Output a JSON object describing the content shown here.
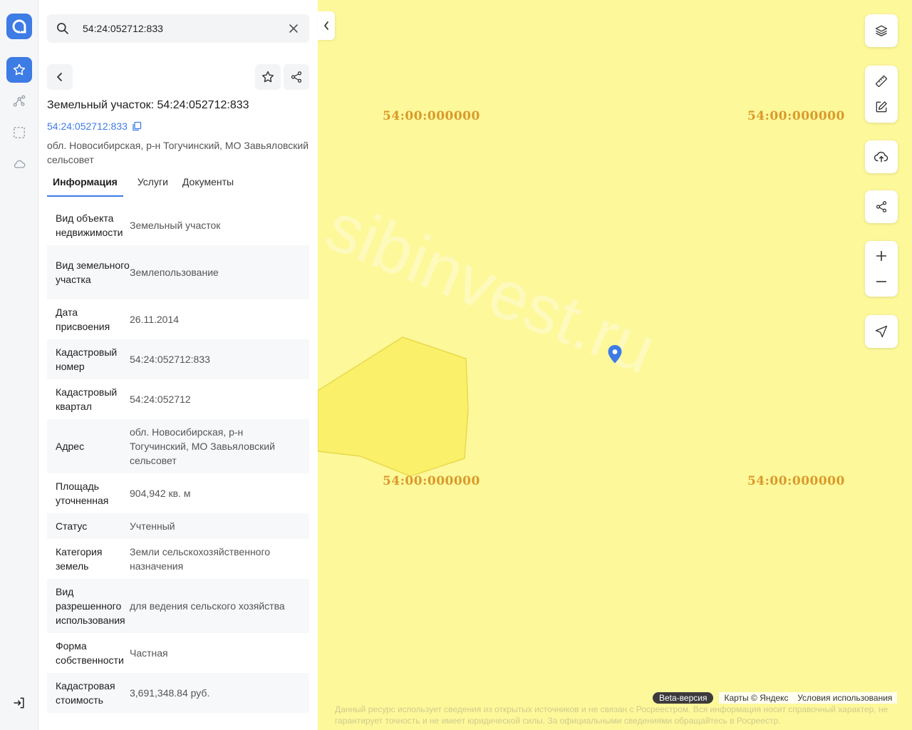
{
  "search": {
    "value": "54:24:052712:833"
  },
  "object": {
    "title": "Земельный участок: 54:24:052712:833",
    "cad_link": "54:24:052712:833",
    "address": "обл. Новосибирская, р-н Тогучинский, МО Завьяловский сельсовет"
  },
  "tabs": [
    {
      "label": "Информация",
      "active": true
    },
    {
      "label": "Услуги",
      "active": false
    },
    {
      "label": "Документы",
      "active": false
    }
  ],
  "info_rows": [
    {
      "key": "Вид объекта недвижимости",
      "value": "Земельный участок"
    },
    {
      "key": "Вид земельного участка",
      "value": "Землепользование"
    },
    {
      "key": "Дата присвоения",
      "value": "26.11.2014"
    },
    {
      "key": "Кадастровый номер",
      "value": "54:24:052712:833"
    },
    {
      "key": "Кадастровый квартал",
      "value": "54:24:052712"
    },
    {
      "key": "Адрес",
      "value": "обл. Новосибирская, р-н Тогучинский, МО Завьяловский сельсовет"
    },
    {
      "key": "Площадь уточненная",
      "value": "904,942 кв. м"
    },
    {
      "key": "Статус",
      "value": "Учтенный"
    },
    {
      "key": "Категория земель",
      "value": "Земли сельскохозяйственного назначения"
    },
    {
      "key": "Вид разрешенного использования",
      "value": "для ведения сельского хозяйства"
    },
    {
      "key": "Форма собственности",
      "value": "Частная"
    },
    {
      "key": "Кадастровая стоимость",
      "value": "3,691,348.84 руб."
    }
  ],
  "map": {
    "quarter_labels": [
      "54:00:000000",
      "54:00:000000",
      "54:00:000000",
      "54:00:000000"
    ],
    "watermark": "sibinvest.ru",
    "beta": "Beta-версия",
    "maps_credit": "Карты © Яндекс",
    "terms": "Условия использования",
    "disclaimer": "Данный ресурс использует сведения из открытых источников и не связан с Росреестром. Вся информация носит справочный характер, не гарантирует точность и не имеет юридической силы. За официальными сведениями обращайтесь в Росреестр."
  },
  "colors": {
    "accent": "#3d7be5",
    "map_fill": "#fdf89a",
    "quarter_label": "#d99a2c"
  },
  "icons": [
    "app-logo-icon",
    "star-icon",
    "route-icon",
    "select-area-icon",
    "cloud-icon",
    "logout-icon",
    "search-icon",
    "close-icon",
    "back-icon",
    "share-icon",
    "copy-icon",
    "chevron-left-icon",
    "layers-icon",
    "ruler-icon",
    "edit-icon",
    "upload-icon",
    "zoom-in-icon",
    "zoom-out-icon",
    "locate-icon",
    "map-pin-icon"
  ]
}
